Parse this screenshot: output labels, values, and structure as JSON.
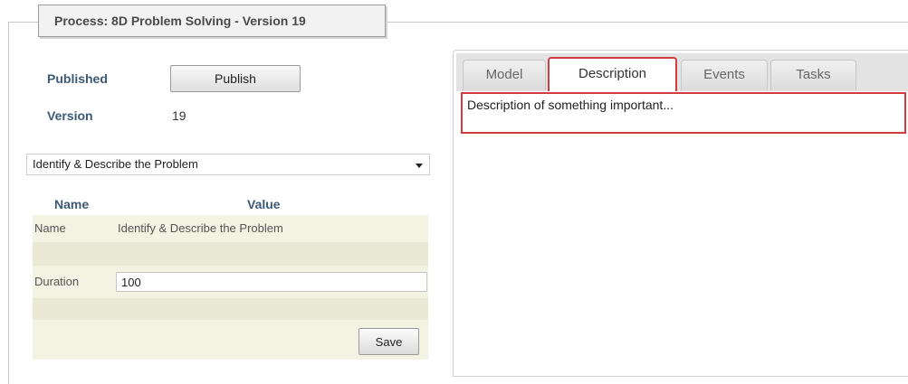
{
  "process": {
    "title": "Process: 8D Problem Solving - Version 19"
  },
  "status": {
    "published_label": "Published",
    "publish_button": "Publish",
    "version_label": "Version",
    "version_value": "19"
  },
  "step_select": {
    "selected": "Identify & Describe the Problem"
  },
  "properties": {
    "headers": {
      "name": "Name",
      "value": "Value"
    },
    "rows": [
      {
        "label": "Name",
        "value": "Identify & Describe the Problem"
      },
      {
        "label": "Duration",
        "value": "100"
      }
    ],
    "save_button": "Save"
  },
  "tabs": {
    "items": [
      "Model",
      "Description",
      "Events",
      "Tasks"
    ],
    "active": "Description"
  },
  "description": {
    "text": "Description of something important..."
  },
  "colors": {
    "highlight": "#d23c3c",
    "label_blue": "#3c5a78",
    "row_bg": "#f3f3e3"
  }
}
